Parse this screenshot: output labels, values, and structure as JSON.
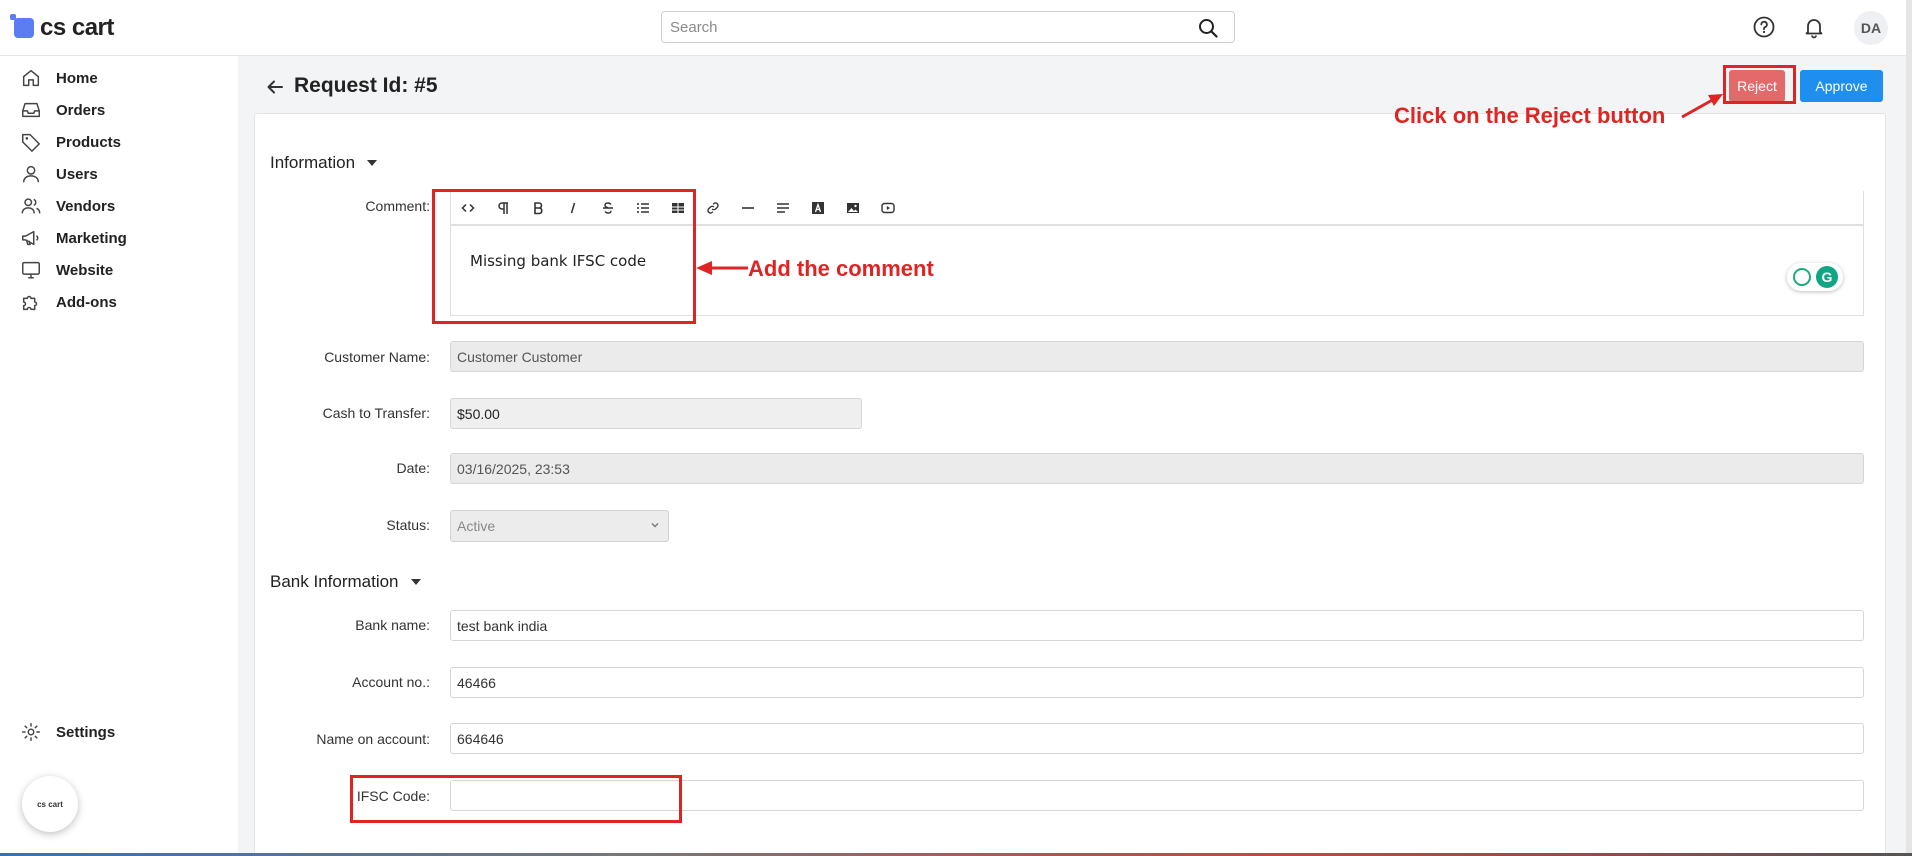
{
  "app": {
    "logo_text": "cs cart"
  },
  "search": {
    "placeholder": "Search"
  },
  "header": {
    "avatar_initials": "DA"
  },
  "sidebar": {
    "items": [
      {
        "label": "Home",
        "icon": "home-icon"
      },
      {
        "label": "Orders",
        "icon": "inbox-icon"
      },
      {
        "label": "Products",
        "icon": "tag-icon"
      },
      {
        "label": "Users",
        "icon": "user-icon"
      },
      {
        "label": "Vendors",
        "icon": "users-icon"
      },
      {
        "label": "Marketing",
        "icon": "megaphone-icon"
      },
      {
        "label": "Website",
        "icon": "monitor-icon"
      },
      {
        "label": "Add-ons",
        "icon": "puzzle-icon"
      }
    ],
    "settings_label": "Settings",
    "widget_text": "cs cart"
  },
  "page": {
    "title": "Request Id: #5",
    "reject_label": "Reject",
    "approve_label": "Approve"
  },
  "information": {
    "section_title": "Information",
    "comment_label": "Comment:",
    "comment_text": "Missing bank IFSC code",
    "customer_name_label": "Customer Name:",
    "customer_name_value": "Customer Customer",
    "cash_label": "Cash to Transfer:",
    "cash_value": "$50.00",
    "date_label": "Date:",
    "date_value": "03/16/2025, 23:53",
    "status_label": "Status:",
    "status_value": "Active"
  },
  "bank": {
    "section_title": "Bank Information",
    "bank_name_label": "Bank name:",
    "bank_name_value": "test bank india",
    "account_label": "Account no.:",
    "account_value": "46466",
    "name_on_account_label": "Name on account:",
    "name_on_account_value": "664646",
    "ifsc_label": "IFSC Code:",
    "ifsc_value": ""
  },
  "annotations": {
    "reject_hint": "Click on the Reject button",
    "comment_hint": "Add the comment",
    "color": "#e02424"
  },
  "colors": {
    "reject": "#e36a6a",
    "approve": "#1f8fef",
    "logo": "#5b7cf2"
  }
}
